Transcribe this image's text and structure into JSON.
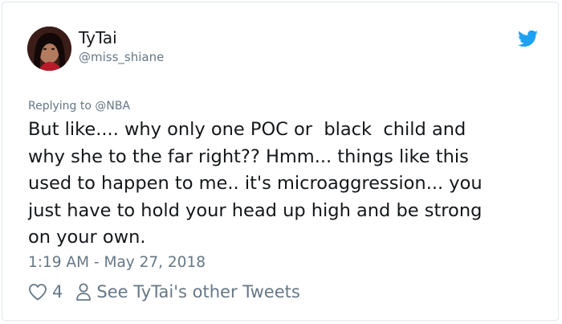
{
  "tweet": {
    "display_name": "TyTai",
    "handle": "@miss_shiane",
    "replying_prefix": "Replying to ",
    "replying_to": "@NBA",
    "text": "But like.... why only one POC or  black  child and\nwhy she to the far right?? Hmm... things like this\nused to happen to me.. it's microaggression... you\njust have to hold your head up high and be strong\non your own.",
    "timestamp": "1:19 AM - May 27, 2018",
    "like_count": "4",
    "other_tweets_label": "See TyTai's other Tweets"
  },
  "icons": {
    "brand": "twitter-bird-icon",
    "like": "heart-icon",
    "profile": "person-icon"
  },
  "colors": {
    "twitter_blue": "#1da1f2",
    "text_primary": "#14171a",
    "text_secondary": "#657786",
    "border": "#e1e8ed"
  }
}
